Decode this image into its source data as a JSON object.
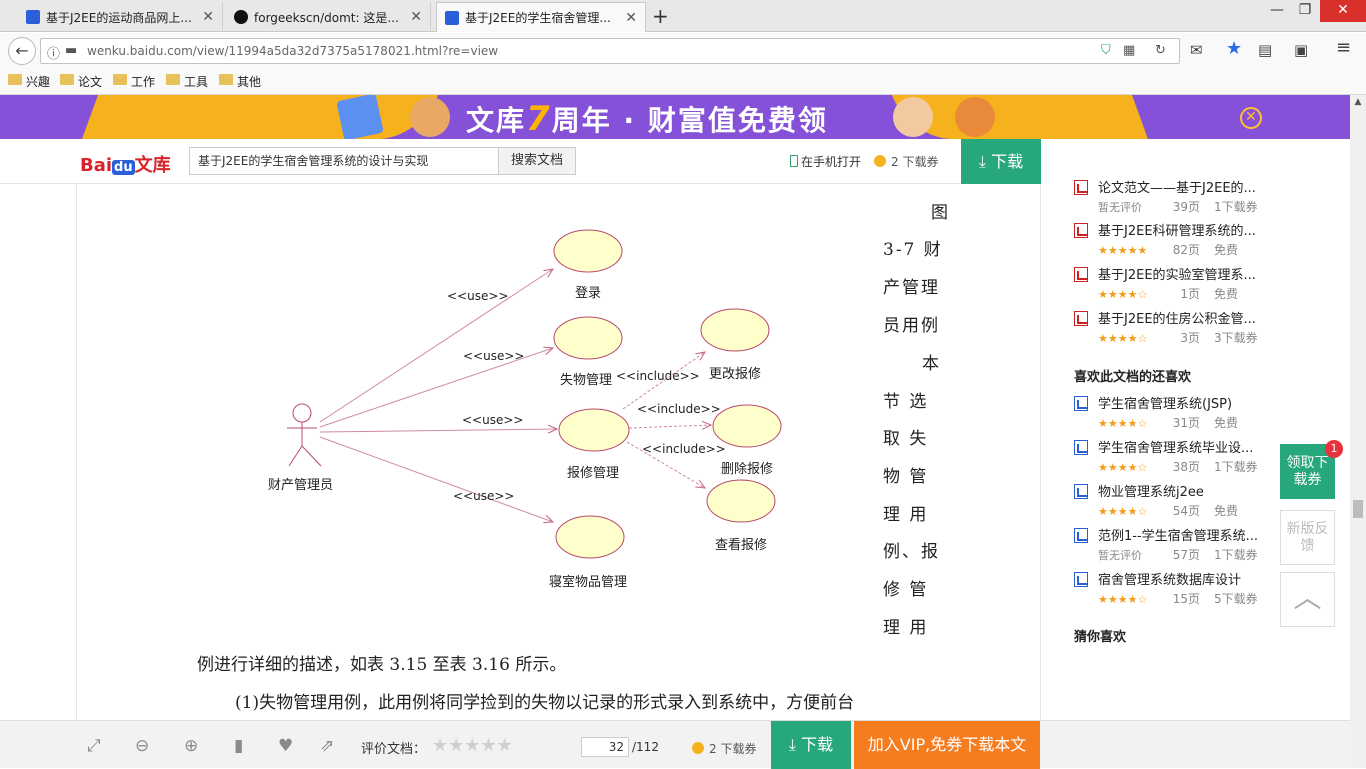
{
  "browser": {
    "tabs": [
      {
        "label": "基于J2EE的运动商品网上...",
        "icon": "baidu-paw-icon"
      },
      {
        "label": "forgeekscn/domt: 这是...",
        "icon": "github-icon"
      },
      {
        "label": "基于J2EE的学生宿舍管理...",
        "icon": "baidu-paw-icon"
      }
    ],
    "new_tab": "+",
    "url": "wenku.baidu.com/view/11994a5da32d7375a5178021.html?re=view",
    "bookmarks": [
      "兴趣",
      "论文",
      "工作",
      "工具",
      "其他"
    ]
  },
  "banner": {
    "text_before": "文库",
    "seven": "7",
    "text_after": "周年 · 财富值免费领",
    "close": "✕"
  },
  "toolbar": {
    "logo_bai": "Bai",
    "logo_du": "du",
    "logo_wenku": "文库",
    "search_value": "基于J2EE的学生宿舍管理系统的设计与实现",
    "search_button": "搜索文档",
    "open_mobile": "在手机打开",
    "coupon": "2 下载券",
    "download": "下载"
  },
  "document": {
    "diagram": {
      "actor": "财产管理员",
      "use_cases": [
        "登录",
        "失物管理",
        "报修管理",
        "寝室物品管理",
        "更改报修",
        "删除报修",
        "查看报修"
      ],
      "use_label": "<<use>>",
      "include_label": "<<include>>"
    },
    "side_text": [
      "图",
      "3-7 财",
      "产管理",
      "员用例",
      "本",
      "节 选",
      "取 失",
      "物 管",
      "理 用",
      "例、报",
      "修 管",
      "理 用"
    ],
    "line1": "例进行详细的描述，如表 3.15 至表 3.16 所示。",
    "line2": "(1)失物管理用例，此用例将同学捡到的失物以记录的形式录入到系统中，方便前台"
  },
  "sidebar": {
    "related": [
      {
        "title": "论文范文——基于J2EE的...",
        "rating": "暂无评价",
        "pages": "39页",
        "cost": "1下载券",
        "type": "pdf"
      },
      {
        "title": "基于J2EE科研管理系统的...",
        "rating": "★★★★★",
        "pages": "82页",
        "cost": "免费",
        "type": "pdf"
      },
      {
        "title": "基于J2EE的实验室管理系...",
        "rating": "★★★★☆",
        "pages": "1页",
        "cost": "免费",
        "type": "pdf"
      },
      {
        "title": "基于J2EE的住房公积金管...",
        "rating": "★★★★☆",
        "pages": "3页",
        "cost": "3下载券",
        "type": "pdf"
      }
    ],
    "liked_heading": "喜欢此文档的还喜欢",
    "liked": [
      {
        "title": "学生宿舍管理系统(JSP)",
        "rating": "★★★★☆",
        "pages": "31页",
        "cost": "免费",
        "type": "word"
      },
      {
        "title": "学生宿舍管理系统毕业设...",
        "rating": "★★★★☆",
        "pages": "38页",
        "cost": "1下载券",
        "type": "word"
      },
      {
        "title": "物业管理系统j2ee",
        "rating": "★★★★☆",
        "pages": "54页",
        "cost": "免费",
        "type": "word"
      },
      {
        "title": "范例1--学生宿舍管理系统...",
        "rating": "暂无评价",
        "pages": "57页",
        "cost": "1下载券",
        "type": "word"
      },
      {
        "title": "宿舍管理系统数据库设计",
        "rating": "★★★★☆",
        "pages": "15页",
        "cost": "5下载券",
        "type": "word"
      }
    ],
    "guess_heading": "猜你喜欢",
    "float_coupon": "领取下载券",
    "float_badge": "1",
    "float_feedback": "新版反馈"
  },
  "bottombar": {
    "rate_label": "评价文档：",
    "rate_stars": "★★★★★",
    "page_current": "32",
    "page_total": "/112",
    "coupon": "2 下载券",
    "download": "下载",
    "vip": "加入VIP,免券下载本文"
  },
  "colors": {
    "brand_green": "#27a77c",
    "vip_orange": "#f57c1f",
    "banner_purple": "#8451d8",
    "ellipse_fill": "#ffffcc",
    "ellipse_stroke": "#b84b6d"
  }
}
